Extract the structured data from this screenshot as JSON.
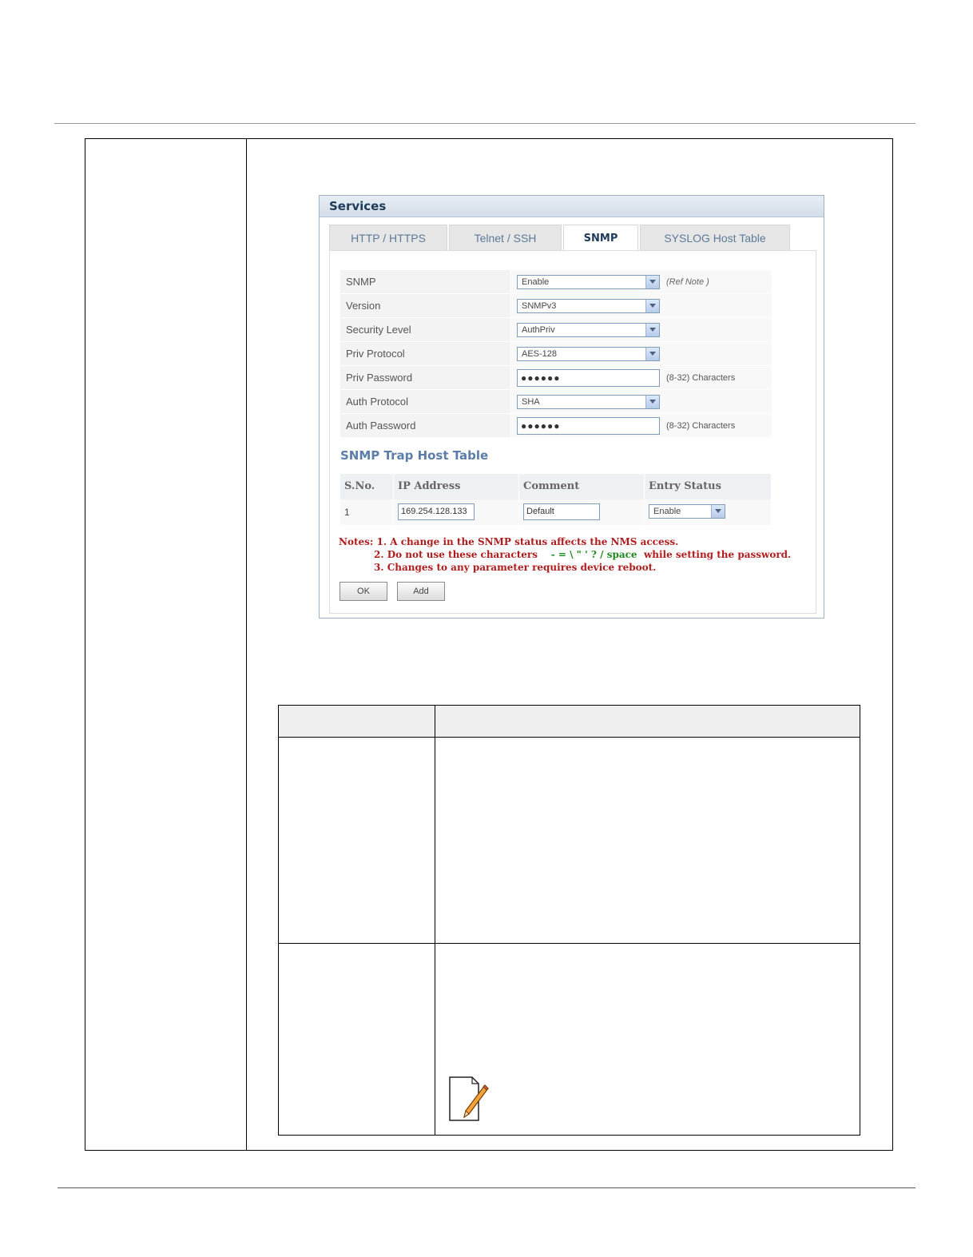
{
  "panel": {
    "title": "Services",
    "tabs": [
      {
        "label": "HTTP / HTTPS",
        "active": false
      },
      {
        "label": "Telnet / SSH",
        "active": false
      },
      {
        "label": "SNMP",
        "active": true
      },
      {
        "label": "SYSLOG Host Table",
        "active": false
      }
    ],
    "fields": {
      "snmp": {
        "label": "SNMP",
        "value": "Enable",
        "hint": "(Ref Note )"
      },
      "version": {
        "label": "Version",
        "value": "SNMPv3"
      },
      "security_level": {
        "label": "Security Level",
        "value": "AuthPriv"
      },
      "priv_protocol": {
        "label": "Priv Protocol",
        "value": "AES-128"
      },
      "priv_password": {
        "label": "Priv Password",
        "value": "●●●●●●",
        "hint": "(8-32) Characters"
      },
      "auth_protocol": {
        "label": "Auth Protocol",
        "value": "SHA"
      },
      "auth_password": {
        "label": "Auth Password",
        "value": "●●●●●●",
        "hint": "(8-32) Characters"
      }
    },
    "trap_table": {
      "title": "SNMP Trap Host Table",
      "headers": [
        "S.No.",
        "IP Address",
        "Comment",
        "Entry Status"
      ],
      "row": {
        "sno": "1",
        "ip": "169.254.128.133",
        "comment": "Default",
        "status": "Enable"
      }
    },
    "notes": {
      "line1": "Notes: 1. A change in the SNMP status affects the NMS access.",
      "line2_prefix": "2. Do not use these characters",
      "line2_chars": "- = \\ \" ' ? / space",
      "line2_suffix": "while setting the password.",
      "line3": "3. Changes to any parameter requires device reboot."
    },
    "buttons": {
      "ok": "OK",
      "add": "Add"
    }
  },
  "colors": {
    "note_red": "#b01c1c",
    "note_green": "#1d8a1d",
    "header_blue": "#1f3b5a",
    "trap_title_blue": "#5b7ea8"
  }
}
